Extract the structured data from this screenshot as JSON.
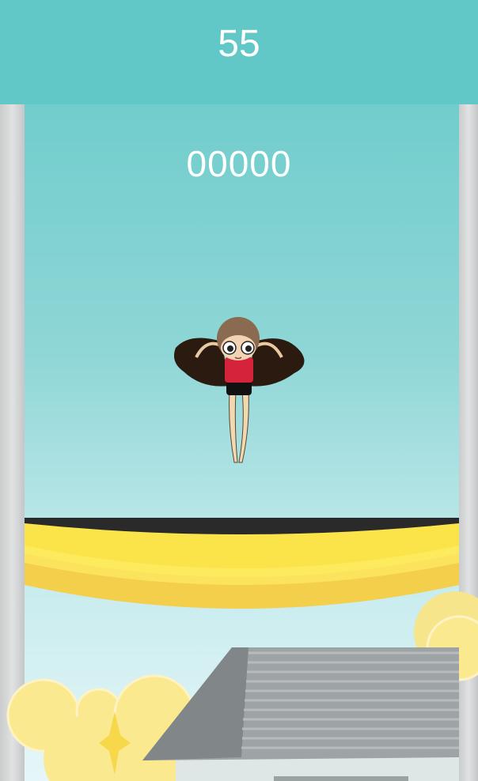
{
  "hud": {
    "timer": "55",
    "score": "00000"
  },
  "colors": {
    "sky_top": "#64c9c8",
    "sky_bottom": "#e6f6f8",
    "topbar": "#62c8c7",
    "trampoline_yellow": "#fbe34a",
    "trampoline_bed": "#2a2a2a",
    "shirt": "#d6233c",
    "hair": "#2a1a10"
  },
  "character": {
    "state": "jumping"
  }
}
